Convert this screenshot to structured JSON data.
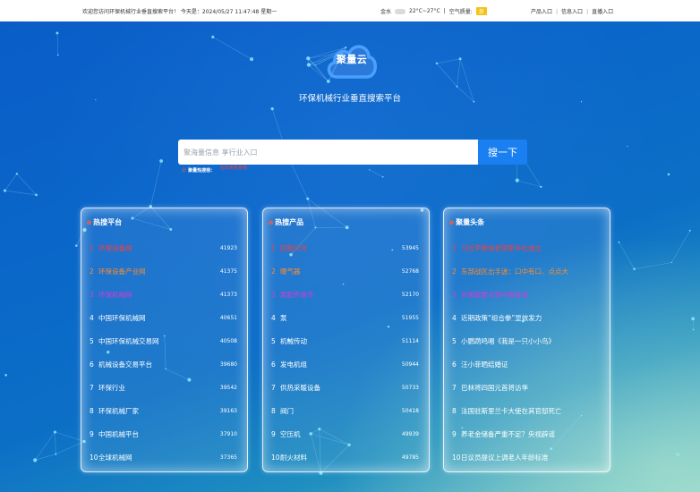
{
  "topbar": {
    "welcome": "欢迎您访问环保机械行业垂直搜索平台！ 今天是：2024/05/27 11:47:48 星期一",
    "city": "金水",
    "temperature": "22°C~27°C",
    "air_quality_label": "空气质量:",
    "air_quality_value": "良",
    "links": [
      "产品入口",
      "信息入口",
      "直播入口"
    ],
    "link_separator": "|"
  },
  "logo": {
    "text": "聚量云"
  },
  "site_title": "环保机械行业垂直搜索平台",
  "search": {
    "placeholder": "聚海量信息 享行业入口",
    "button_label": "搜一下"
  },
  "hot_words": {
    "label": "聚量热搜榜：",
    "items": [
      "拉出来看看看"
    ]
  },
  "panels": [
    {
      "title": "热搜平台",
      "items": [
        {
          "rank": "1",
          "name": "环保设备网",
          "count": "41923"
        },
        {
          "rank": "2",
          "name": "环保设备产业网",
          "count": "41375"
        },
        {
          "rank": "3",
          "name": "环保机械网",
          "count": "41373"
        },
        {
          "rank": "4",
          "name": "中国环保机械网",
          "count": "40651"
        },
        {
          "rank": "5",
          "name": "中国环保机械交易网",
          "count": "40508"
        },
        {
          "rank": "6",
          "name": "机械设备交易平台",
          "count": "39680"
        },
        {
          "rank": "7",
          "name": "环保行业",
          "count": "39542"
        },
        {
          "rank": "8",
          "name": "环保机械厂家",
          "count": "39163"
        },
        {
          "rank": "9",
          "name": "中国机械平台",
          "count": "37910"
        },
        {
          "rank": "10",
          "name": "全球机械网",
          "count": "37365"
        }
      ]
    },
    {
      "title": "热搜产品",
      "items": [
        {
          "rank": "1",
          "name": "控制元件",
          "count": "53945"
        },
        {
          "rank": "2",
          "name": "曝气器",
          "count": "52768"
        },
        {
          "rank": "3",
          "name": "泵配件组件",
          "count": "52170"
        },
        {
          "rank": "4",
          "name": "泵",
          "count": "51955"
        },
        {
          "rank": "5",
          "name": "机械传动",
          "count": "51114"
        },
        {
          "rank": "6",
          "name": "发电机组",
          "count": "50944"
        },
        {
          "rank": "7",
          "name": "供热采暖设备",
          "count": "50733"
        },
        {
          "rank": "8",
          "name": "阀门",
          "count": "50418"
        },
        {
          "rank": "9",
          "name": "空压机",
          "count": "49939"
        },
        {
          "rank": "10",
          "name": "耐火材料",
          "count": "49785"
        }
      ]
    },
    {
      "title": "聚量头条",
      "items": [
        {
          "rank": "1",
          "name": "习近平致信祝贺新华社成立"
        },
        {
          "rank": "2",
          "name": "东部战区出手迷：口中有口、点点大"
        },
        {
          "rank": "3",
          "name": "外国政要点赞中国奇迹"
        },
        {
          "rank": "4",
          "name": "近期政策“组合拳”显效发力"
        },
        {
          "rank": "5",
          "name": "小鹦鹉鸣唱《我是一只小小鸟》"
        },
        {
          "rank": "6",
          "name": "汪小菲晒结婚证"
        },
        {
          "rank": "7",
          "name": "巴林将四国元首将访华"
        },
        {
          "rank": "8",
          "name": "法国驻斯里兰卡大使在其官邸死亡"
        },
        {
          "rank": "9",
          "name": "养老金储备严重不足？央视辟谣"
        },
        {
          "rank": "10",
          "name": "日议员提议上调老人年龄标准"
        }
      ]
    }
  ],
  "colors": {
    "rank_1": "#ff3b3b",
    "rank_2": "#ff8b2b",
    "rank_3": "#d63ad6",
    "search_button": "#1a7ff0",
    "aqi_badge": "#f5c218"
  }
}
